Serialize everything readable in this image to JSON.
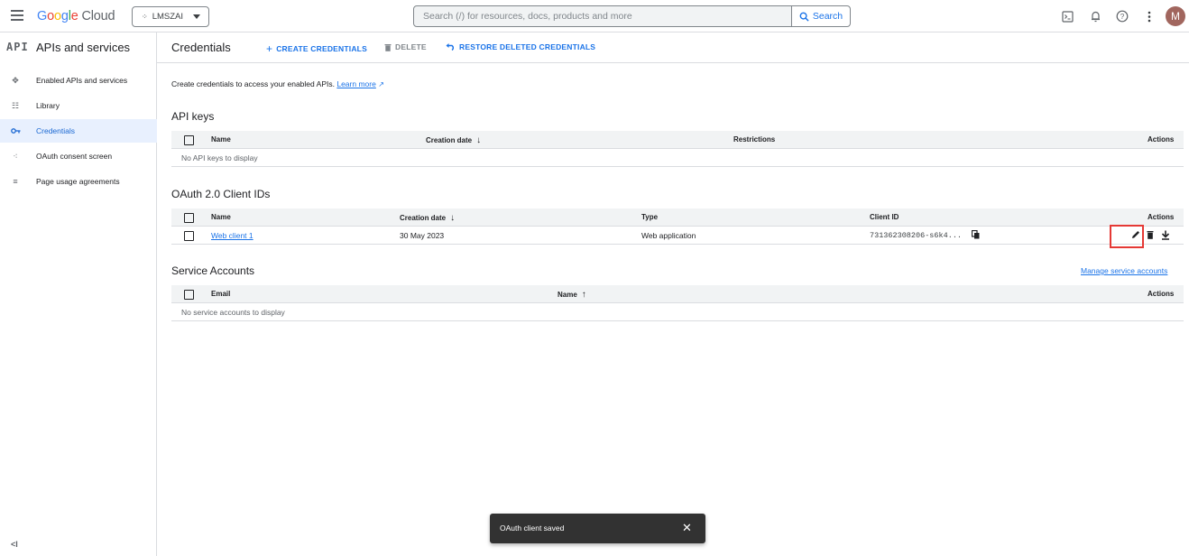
{
  "topbar": {
    "logo_google": [
      "G",
      "o",
      "o",
      "g",
      "l",
      "e"
    ],
    "logo_cloud": "Cloud",
    "project": "LMSZAI",
    "search_placeholder": "Search (/) for resources, docs, products and more",
    "search_button": "Search",
    "avatar_initial": "M"
  },
  "sidebar": {
    "title": "APIs and services",
    "api_icon": "API",
    "items": [
      {
        "label": "Enabled APIs and services",
        "icon": "move-icon"
      },
      {
        "label": "Library",
        "icon": "library-icon"
      },
      {
        "label": "Credentials",
        "icon": "key-icon",
        "active": true
      },
      {
        "label": "OAuth consent screen",
        "icon": "dots-icon"
      },
      {
        "label": "Page usage agreements",
        "icon": "settings-list-icon"
      }
    ]
  },
  "header": {
    "title": "Credentials",
    "create": "CREATE CREDENTIALS",
    "delete": "DELETE",
    "restore": "RESTORE DELETED CREDENTIALS"
  },
  "intro": {
    "text": "Create credentials to access your enabled APIs.",
    "learn_more": "Learn more"
  },
  "api_keys": {
    "title": "API keys",
    "columns": [
      "Name",
      "Creation date",
      "Restrictions",
      "Actions"
    ],
    "empty": "No API keys to display"
  },
  "oauth": {
    "title": "OAuth 2.0 Client IDs",
    "columns": [
      "Name",
      "Creation date",
      "Type",
      "Client ID",
      "Actions"
    ],
    "rows": [
      {
        "name": "Web client 1",
        "date": "30 May 2023",
        "type": "Web application",
        "client_id": "731362308206-s6k4..."
      }
    ]
  },
  "service_accounts": {
    "title": "Service Accounts",
    "manage": "Manage service accounts",
    "columns": [
      "Email",
      "Name",
      "Actions"
    ],
    "empty": "No service accounts to display"
  },
  "snackbar": {
    "message": "OAuth client saved"
  },
  "colors": {
    "accent": "#1a73e8",
    "highlight": "#e53935"
  }
}
